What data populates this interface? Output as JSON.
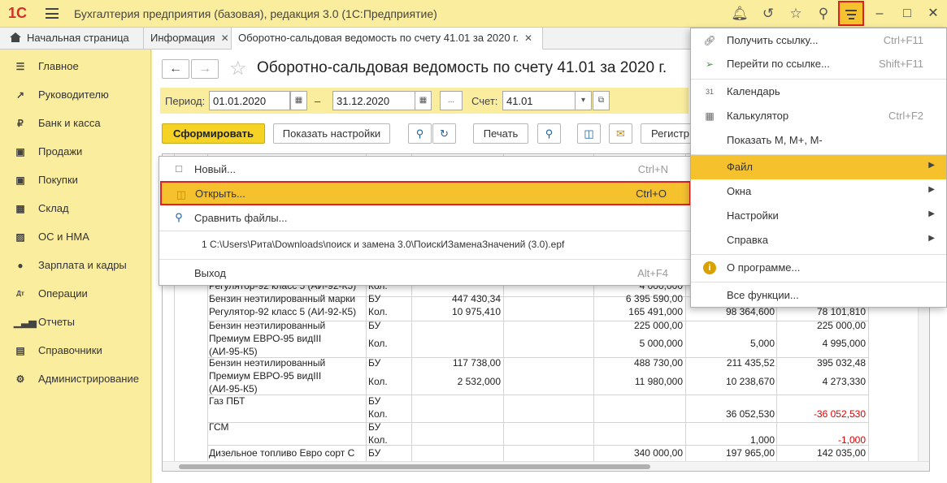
{
  "app": {
    "logo": "1С",
    "title": "Бухгалтерия предприятия (базовая), редакция 3.0  (1С:Предприятие)"
  },
  "colors": {
    "accent": "#f5c22e",
    "highlight_border": "#e0201a",
    "panel": "#fbed9e",
    "negative": "#e00000"
  },
  "tabs": [
    {
      "label": "Начальная страница",
      "icon": "home-icon"
    },
    {
      "label": "Информация"
    },
    {
      "label": "Оборотно-сальдовая ведомость по счету 41.01 за 2020 г."
    }
  ],
  "sidebar": {
    "items": [
      {
        "label": "Главное",
        "icon": "list-icon"
      },
      {
        "label": "Руководителю",
        "icon": "trend-icon"
      },
      {
        "label": "Банк и касса",
        "icon": "coin-icon"
      },
      {
        "label": "Продажи",
        "icon": "bag-icon"
      },
      {
        "label": "Покупки",
        "icon": "cart-icon"
      },
      {
        "label": "Склад",
        "icon": "warehouse-icon"
      },
      {
        "label": "ОС и НМА",
        "icon": "truck-icon"
      },
      {
        "label": "Зарплата и кадры",
        "icon": "person-icon"
      },
      {
        "label": "Операции",
        "icon": "dt-kt-icon"
      },
      {
        "label": "Отчеты",
        "icon": "bar-chart-icon"
      },
      {
        "label": "Справочники",
        "icon": "book-icon"
      },
      {
        "label": "Администрирование",
        "icon": "gear-icon"
      }
    ]
  },
  "report": {
    "title": "Оборотно-сальдовая ведомость по счету 41.01 за 2020 г.",
    "period_label": "Период:",
    "date_from": "01.01.2020",
    "dash": "–",
    "date_to": "31.12.2020",
    "ellipsis": "...",
    "account_label": "Счет:",
    "account": "41.01",
    "buttons": {
      "generate": "Сформировать",
      "show_settings": "Показать настройки",
      "print": "Печать",
      "register": "Регистр"
    }
  },
  "table": {
    "rows": [
      {
        "name": "Регулятор-92 класс 5 (АИ-92-К5)",
        "type": "Кол.",
        "c1": "",
        "c2": "4 000,000",
        "c3": "",
        "c4": ""
      },
      {
        "name": "Бензин неэтилированный марки",
        "type": "БУ",
        "c1": "447 430,34",
        "c2": "6 395 590,00",
        "c3": "",
        "c4": ""
      },
      {
        "name": "Регулятор-92 класс 5 (АИ-92-К5)",
        "type": "Кол.",
        "c1": "10 975,410",
        "c2": "165 491,000",
        "c3": "98 364,600",
        "c4": "78 101,810"
      },
      {
        "name": "Бензин неэтилированный",
        "type": "БУ",
        "c1": "",
        "c2": "225 000,00",
        "c3": "",
        "c4": "225 000,00"
      },
      {
        "name": "Премиум ЕВРО-95 видIII",
        "type": "",
        "c1": "",
        "c2": "",
        "c3": "",
        "c4": ""
      },
      {
        "name": "(АИ-95-К5)",
        "type": "Кол.",
        "c1": "",
        "c2": "5 000,000",
        "c3": "5,000",
        "c4": "4 995,000"
      },
      {
        "name": "Бензин неэтилированный",
        "type": "БУ",
        "c1": "117 738,00",
        "c2": "488 730,00",
        "c3": "211 435,52",
        "c4": "395 032,48"
      },
      {
        "name": "Премиум ЕВРО-95 видIII",
        "type": "",
        "c1": "",
        "c2": "",
        "c3": "",
        "c4": ""
      },
      {
        "name": "(АИ-95-К5)",
        "type": "Кол.",
        "c1": "2 532,000",
        "c2": "11 980,000",
        "c3": "10 238,670",
        "c4": "4 273,330"
      },
      {
        "name": "Газ ПБТ",
        "type": "БУ",
        "c1": "",
        "c2": "",
        "c3": "",
        "c4": ""
      },
      {
        "name": "",
        "type": "Кол.",
        "c1": "",
        "c2": "",
        "c3": "36 052,530",
        "c4": "-36 052,530"
      },
      {
        "name": "ГСМ",
        "type": "БУ",
        "c1": "",
        "c2": "",
        "c3": "",
        "c4": ""
      },
      {
        "name": "",
        "type": "Кол.",
        "c1": "",
        "c2": "",
        "c3": "1,000",
        "c4": "-1,000"
      },
      {
        "name": "Дизельное топливо Евро сорт С",
        "type": "БУ",
        "c1": "",
        "c2": "340 000,00",
        "c3": "197 965,00",
        "c4": "142 035,00"
      }
    ]
  },
  "file_menu": {
    "items": [
      {
        "label": "Новый...",
        "shortcut": "Ctrl+N",
        "icon": "new-file-icon"
      },
      {
        "label": "Открыть...",
        "shortcut": "Ctrl+O",
        "icon": "open-folder-icon"
      },
      {
        "label": "Сравнить файлы...",
        "shortcut": "",
        "icon": "compare-files-icon"
      },
      {
        "label": "1 C:\\Users\\Рита\\Downloads\\поиск и замена 3.0\\ПоискИЗаменаЗначений (3.0).epf",
        "shortcut": ""
      },
      {
        "label": "Выход",
        "shortcut": "Alt+F4"
      }
    ]
  },
  "main_menu": {
    "items": [
      {
        "label": "Получить ссылку...",
        "shortcut": "Ctrl+F11",
        "icon": "link-icon"
      },
      {
        "label": "Перейти по ссылке...",
        "shortcut": "Shift+F11",
        "icon": "go-link-icon"
      },
      {
        "label": "Календарь",
        "shortcut": "",
        "icon": "calendar-icon"
      },
      {
        "label": "Калькулятор",
        "shortcut": "Ctrl+F2",
        "icon": "calculator-icon"
      },
      {
        "label": "Показать М, М+, М-",
        "shortcut": ""
      },
      {
        "label": "Файл",
        "submenu": true
      },
      {
        "label": "Окна",
        "submenu": true
      },
      {
        "label": "Настройки",
        "submenu": true
      },
      {
        "label": "Справка",
        "submenu": true
      },
      {
        "label": "О программе...",
        "shortcut": "",
        "icon": "info-icon"
      },
      {
        "label": "Все функции...",
        "shortcut": ""
      }
    ]
  }
}
